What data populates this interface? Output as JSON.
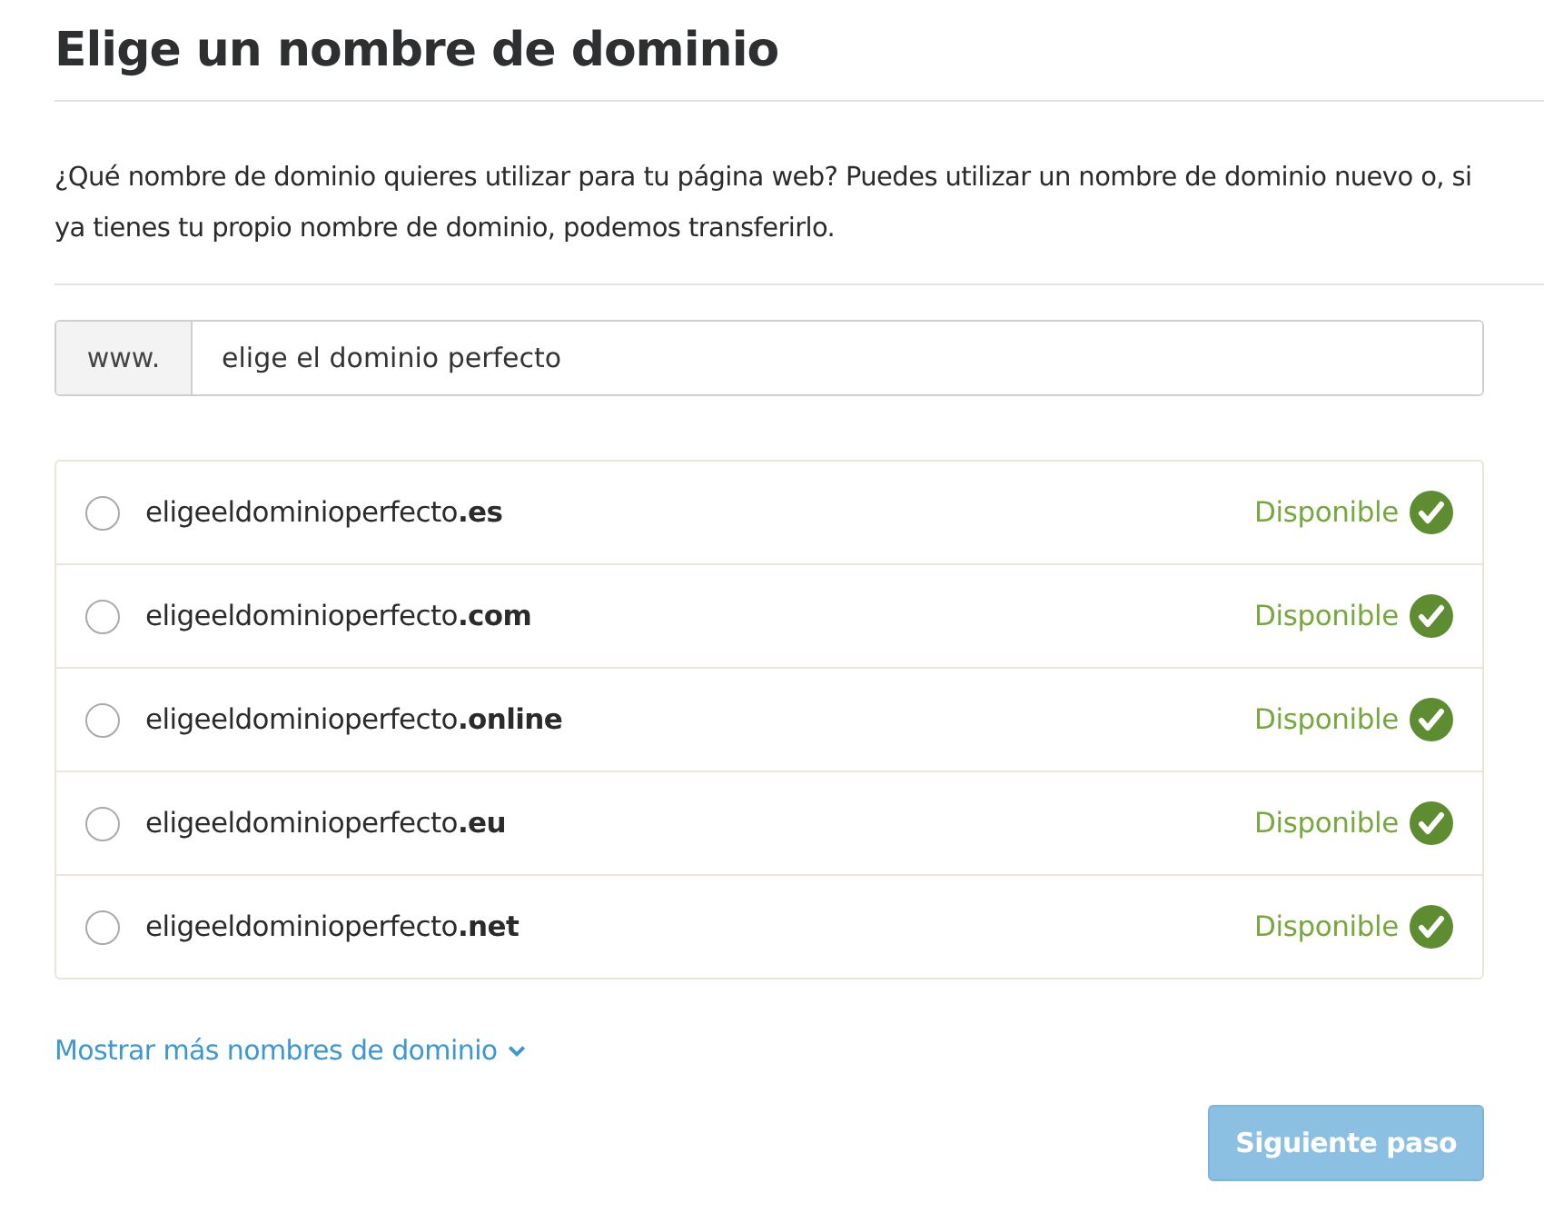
{
  "title": "Elige un nombre de dominio",
  "description": "¿Qué nombre de dominio quieres utilizar para tu página web? Puedes utilizar un nombre de dominio nuevo o, si ya tienes tu propio nombre de dominio, podemos transferirlo.",
  "domain_field": {
    "prefix": "www.",
    "value": "elige el dominio perfecto"
  },
  "domains": [
    {
      "name": "eligeeldominioperfecto**.es**",
      "selected": false,
      "status": "Disponible",
      "available": true
    },
    {
      "name": "eligeeldominioperfecto**.com**",
      "selected": false,
      "status": "Disponible",
      "available": true
    },
    {
      "name": "eligeeldominioperfecto**.online**",
      "selected": false,
      "status": "Disponible",
      "available": true
    },
    {
      "name": "eligeeldominioperfecto**.eu**",
      "selected": false,
      "status": "Disponible",
      "available": true
    },
    {
      "name": "eligeeldominioperfecto**.net**",
      "selected": false,
      "status": "Disponible",
      "available": true
    }
  ],
  "more_link": "Mostrar más nombres de dominio",
  "next_button": {
    "label": "Siguiente paso",
    "disabled": true
  }
}
